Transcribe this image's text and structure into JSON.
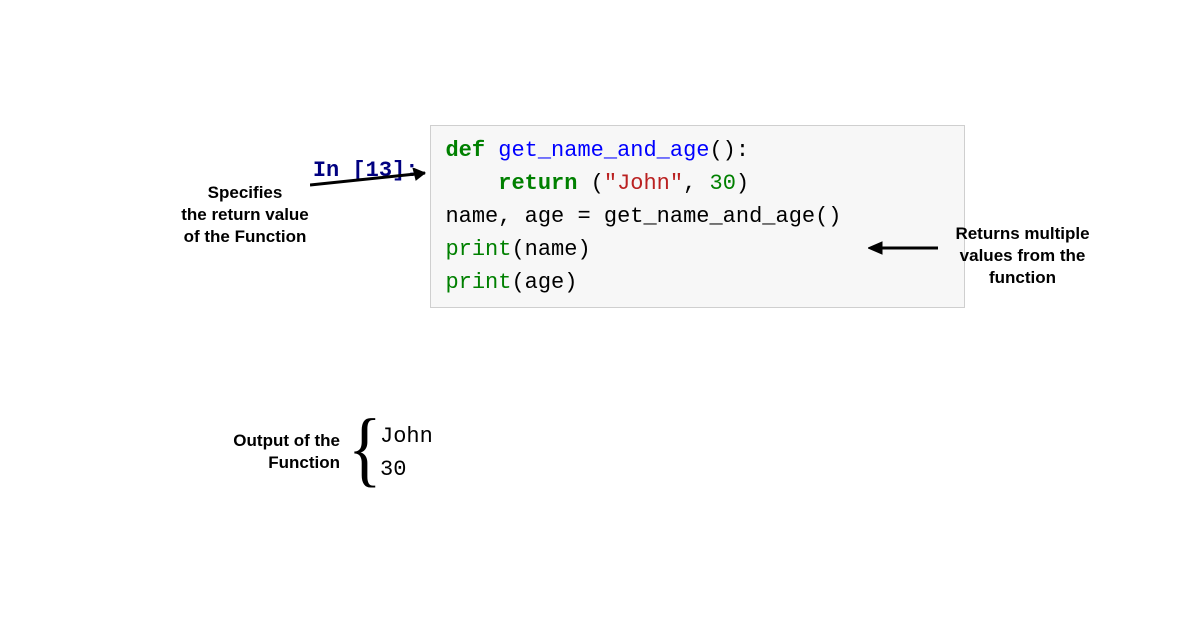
{
  "prompt": {
    "label": "In [13]:"
  },
  "code": {
    "line1": {
      "def": "def",
      "fname": "get_name_and_age",
      "parens": "():"
    },
    "line2": {
      "indent": "    ",
      "return": "return",
      "open": " (",
      "str": "\"John\"",
      "comma": ", ",
      "num": "30",
      "close": ")"
    },
    "line3": "",
    "line4": {
      "text": "name, age = get_name_and_age()"
    },
    "line5": {
      "print": "print",
      "arg": "(name)"
    },
    "line6": {
      "print": "print",
      "arg": "(age)"
    }
  },
  "output": {
    "line1": "John",
    "line2": "30"
  },
  "annotations": {
    "left": "Specifies\nthe return value\nof the Function",
    "right": "Returns multiple\nvalues from the\nfunction",
    "output": "Output of the\nFunction"
  }
}
